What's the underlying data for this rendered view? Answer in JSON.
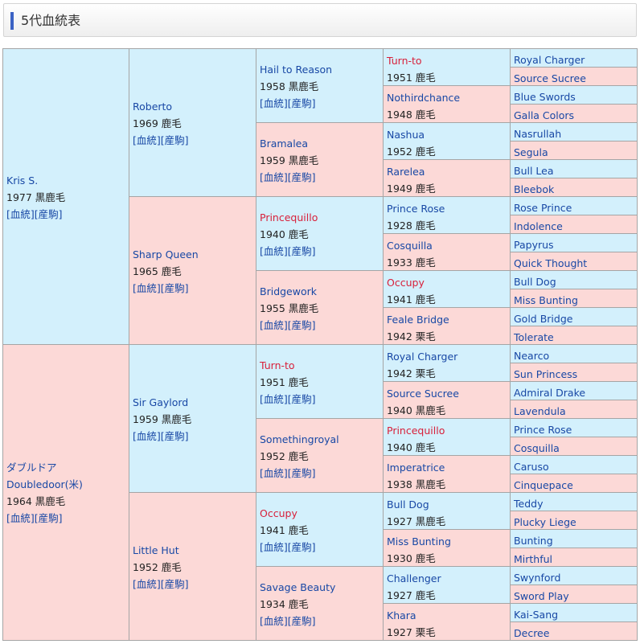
{
  "header": {
    "title": "5代血統表"
  },
  "accent_colors": {
    "sire_bg": "#d3f0fc",
    "dam_bg": "#fcd9d7",
    "link": "#1848a5",
    "highlight": "#d8203a"
  },
  "links_label": "[血統][産駒]",
  "columns": [
    [
      {
        "name": "Kris S.",
        "sub": "1977 黒鹿毛",
        "links": true,
        "red": false
      },
      {
        "name": "ダブルドア",
        "name2": "Doubledoor(米)",
        "sub": "1964 黒鹿毛",
        "links": true,
        "red": false
      }
    ],
    [
      {
        "name": "Roberto",
        "sub": "1969 鹿毛",
        "links": true,
        "red": false
      },
      {
        "name": "Sharp Queen",
        "sub": "1965 鹿毛",
        "links": true,
        "red": false
      },
      {
        "name": "Sir Gaylord",
        "sub": "1959 黒鹿毛",
        "links": true,
        "red": false
      },
      {
        "name": "Little Hut",
        "sub": "1952 鹿毛",
        "links": true,
        "red": false
      }
    ],
    [
      {
        "name": "Hail to Reason",
        "sub": "1958 黒鹿毛",
        "links": true,
        "red": false
      },
      {
        "name": "Bramalea",
        "sub": "1959 黒鹿毛",
        "links": true,
        "red": false
      },
      {
        "name": "Princequillo",
        "sub": "1940 鹿毛",
        "links": true,
        "red": true
      },
      {
        "name": "Bridgework",
        "sub": "1955 黒鹿毛",
        "links": true,
        "red": false
      },
      {
        "name": "Turn-to",
        "sub": "1951 鹿毛",
        "links": true,
        "red": true
      },
      {
        "name": "Somethingroyal",
        "sub": "1952 鹿毛",
        "links": true,
        "red": false
      },
      {
        "name": "Occupy",
        "sub": "1941 鹿毛",
        "links": true,
        "red": true
      },
      {
        "name": "Savage Beauty",
        "sub": "1934 鹿毛",
        "links": true,
        "red": false
      }
    ],
    [
      {
        "name": "Turn-to",
        "sub": "1951 鹿毛",
        "red": true
      },
      {
        "name": "Nothirdchance",
        "sub": "1948 鹿毛",
        "red": false
      },
      {
        "name": "Nashua",
        "sub": "1952 鹿毛",
        "red": false
      },
      {
        "name": "Rarelea",
        "sub": "1949 鹿毛",
        "red": false
      },
      {
        "name": "Prince Rose",
        "sub": "1928 鹿毛",
        "red": false
      },
      {
        "name": "Cosquilla",
        "sub": "1933 鹿毛",
        "red": false
      },
      {
        "name": "Occupy",
        "sub": "1941 鹿毛",
        "red": true
      },
      {
        "name": "Feale Bridge",
        "sub": "1942 栗毛",
        "red": false
      },
      {
        "name": "Royal Charger",
        "sub": "1942 栗毛",
        "red": false
      },
      {
        "name": "Source Sucree",
        "sub": "1940 黒鹿毛",
        "red": false
      },
      {
        "name": "Princequillo",
        "sub": "1940 鹿毛",
        "red": true
      },
      {
        "name": "Imperatrice",
        "sub": "1938 黒鹿毛",
        "red": false
      },
      {
        "name": "Bull Dog",
        "sub": "1927 黒鹿毛",
        "red": false
      },
      {
        "name": "Miss Bunting",
        "sub": "1930 鹿毛",
        "red": false
      },
      {
        "name": "Challenger",
        "sub": "1927 鹿毛",
        "red": false
      },
      {
        "name": "Khara",
        "sub": "1927 栗毛",
        "red": false
      }
    ],
    [
      {
        "name": "Royal Charger"
      },
      {
        "name": "Source Sucree"
      },
      {
        "name": "Blue Swords"
      },
      {
        "name": "Galla Colors"
      },
      {
        "name": "Nasrullah"
      },
      {
        "name": "Segula"
      },
      {
        "name": "Bull Lea"
      },
      {
        "name": "Bleebok"
      },
      {
        "name": "Rose Prince"
      },
      {
        "name": "Indolence"
      },
      {
        "name": "Papyrus"
      },
      {
        "name": "Quick Thought"
      },
      {
        "name": "Bull Dog"
      },
      {
        "name": "Miss Bunting"
      },
      {
        "name": "Gold Bridge"
      },
      {
        "name": "Tolerate"
      },
      {
        "name": "Nearco"
      },
      {
        "name": "Sun Princess"
      },
      {
        "name": "Admiral Drake"
      },
      {
        "name": "Lavendula"
      },
      {
        "name": "Prince Rose"
      },
      {
        "name": "Cosquilla"
      },
      {
        "name": "Caruso"
      },
      {
        "name": "Cinquepace"
      },
      {
        "name": "Teddy"
      },
      {
        "name": "Plucky Liege"
      },
      {
        "name": "Bunting"
      },
      {
        "name": "Mirthful"
      },
      {
        "name": "Swynford"
      },
      {
        "name": "Sword Play"
      },
      {
        "name": "Kai-Sang"
      },
      {
        "name": "Decree"
      }
    ]
  ]
}
